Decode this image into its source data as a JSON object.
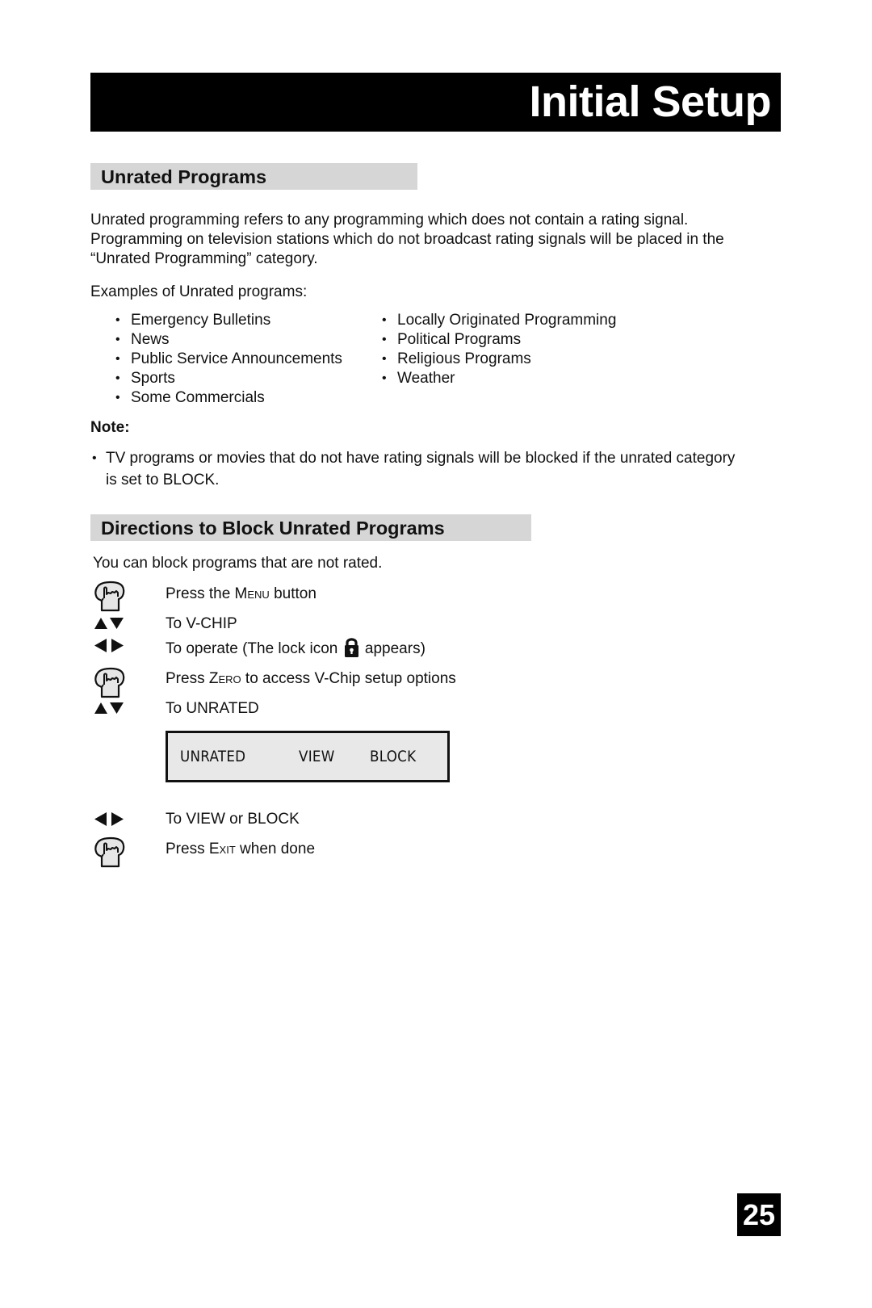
{
  "header": {
    "title": "Initial Setup"
  },
  "section_unrated": {
    "heading": "Unrated Programs",
    "paragraph_lines": [
      "Unrated programming refers to any programming which does not contain a rating signal.",
      "Programming on television stations which do not broadcast rating signals will be placed in the",
      "“Unrated Programming” category."
    ],
    "examples_label": "Examples of Unrated programs:",
    "examples_left": [
      "Emergency Bulletins",
      "News",
      "Public Service Announcements",
      "Sports",
      "Some Commercials"
    ],
    "examples_right": [
      "Locally Originated Programming",
      "Political Programs",
      "Religious Programs",
      "Weather"
    ],
    "bullet": "•",
    "note_label": "Note:",
    "note_lines": [
      "TV programs or movies that do not have rating signals will be blocked if the unrated category",
      "is set to BLOCK."
    ]
  },
  "section_directions": {
    "heading": "Directions to Block Unrated Programs",
    "intro": "You can block programs that are not rated.",
    "steps": [
      {
        "icon": "hand-press-icon",
        "pre": "Press the ",
        "key": "Menu",
        "post": " button"
      },
      {
        "icon": "up-down-arrows-icon",
        "pre": "To V-CHIP",
        "key": "",
        "post": ""
      },
      {
        "icon": "left-right-arrows-icon",
        "pre": "To operate (The lock icon ",
        "key": "",
        "post": " appears)"
      },
      {
        "icon": "hand-press-icon",
        "pre": "Press ",
        "key": "Zero",
        "post": " to access V-Chip setup options"
      },
      {
        "icon": "up-down-arrows-icon",
        "pre": "To UNRATED",
        "key": "",
        "post": ""
      },
      {
        "icon": "left-right-arrows-icon",
        "pre": "To VIEW or BLOCK",
        "key": "",
        "post": ""
      },
      {
        "icon": "hand-press-icon",
        "pre": "Press ",
        "key": "Exit",
        "post": " when done"
      }
    ],
    "osd": {
      "label": "UNRATED",
      "option_view": "VIEW",
      "option_block": "BLOCK"
    }
  },
  "footer": {
    "page_number": "25"
  }
}
